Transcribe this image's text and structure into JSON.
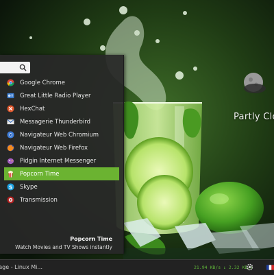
{
  "menu": {
    "search": {
      "value": ""
    },
    "apps": [
      {
        "label": "Google Chrome",
        "icon": "chrome-icon",
        "selected": false
      },
      {
        "label": "Great Little Radio Player",
        "icon": "radio-icon",
        "selected": false
      },
      {
        "label": "HexChat",
        "icon": "hexchat-icon",
        "selected": false
      },
      {
        "label": "Messagerie Thunderbird",
        "icon": "thunderbird-icon",
        "selected": false
      },
      {
        "label": "Navigateur Web Chromium",
        "icon": "chromium-icon",
        "selected": false
      },
      {
        "label": "Navigateur Web Firefox",
        "icon": "firefox-icon",
        "selected": false
      },
      {
        "label": "Pidgin Internet Messenger",
        "icon": "pidgin-icon",
        "selected": false
      },
      {
        "label": "Popcorn Time",
        "icon": "popcorn-icon",
        "selected": true
      },
      {
        "label": "Skype",
        "icon": "skype-icon",
        "selected": false
      },
      {
        "label": "Transmission",
        "icon": "transmission-icon",
        "selected": false
      }
    ],
    "description": {
      "title": "Popcorn Time",
      "text": "Watch Movies and TV Shows instantly"
    }
  },
  "desklet": {
    "weather_label": "Partly Clou"
  },
  "panel": {
    "task_label": "rt Page - Linux Mi...",
    "net_speed": "21.94 KB/s ↓ 2.32 KB/s"
  },
  "colors": {
    "accent": "#6bb331",
    "net_text": "#5fb53a",
    "menu_bg": "#282828"
  }
}
